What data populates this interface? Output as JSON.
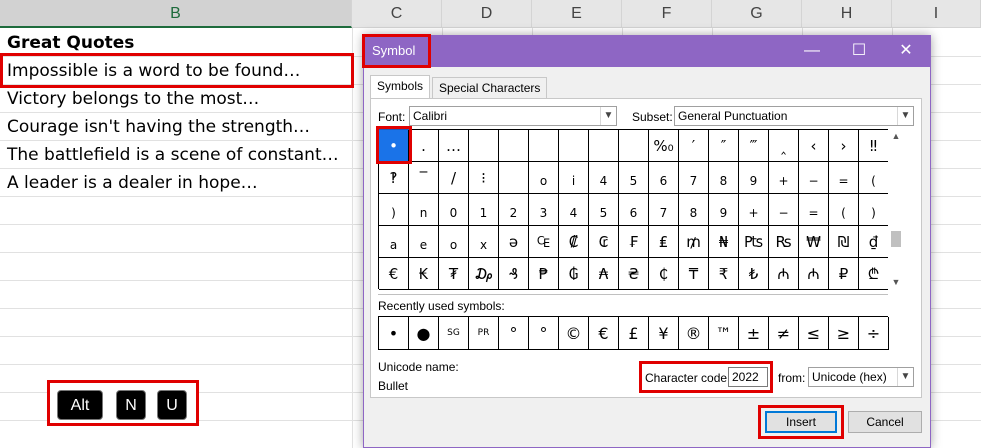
{
  "sheet": {
    "columns": [
      "B",
      "C",
      "D",
      "E",
      "F",
      "G",
      "H",
      "I"
    ],
    "cells": [
      "Great Quotes",
      "Impossible is a word to be found…",
      "Victory belongs to the most…",
      "Courage isn't having the strength…",
      "The battlefield is a scene of constant…",
      "A leader is a dealer in hope…"
    ]
  },
  "keys": [
    "Alt",
    "N",
    "U"
  ],
  "dialog": {
    "title": "Symbol",
    "controls": {
      "minimize": "—",
      "maximize": "☐",
      "close": "✕"
    },
    "tabs": [
      "Symbols",
      "Special Characters"
    ],
    "font_label": "Font:",
    "font_value": "Calibri",
    "subset_label": "Subset:",
    "subset_value": "General Punctuation",
    "symbols": [
      "•",
      ".",
      "…",
      "",
      "",
      "",
      "",
      "",
      "",
      "%₀",
      "′",
      "″",
      "‴",
      "‸",
      "‹",
      "›",
      "‼",
      "‽",
      "‾",
      "/",
      "⁝",
      "",
      "o",
      "i",
      "4",
      "5",
      "6",
      "7",
      "8",
      "9",
      "+",
      "−",
      "=",
      "(",
      ")",
      "n",
      "0",
      "1",
      "2",
      "3",
      "4",
      "5",
      "6",
      "7",
      "8",
      "9",
      "+",
      "−",
      "=",
      "(",
      ")",
      "a",
      "e",
      "o",
      "x",
      "ə",
      "₠",
      "₡",
      "₢",
      "₣",
      "₤",
      "₥",
      "₦",
      "₧",
      "₨",
      "₩",
      "₪",
      "₫",
      "€",
      "₭",
      "₮",
      "₯",
      "₰",
      "₱",
      "₲",
      "₳",
      "₴",
      "₵",
      "₸",
      "₹",
      "₺",
      "₼",
      "₼",
      "₽",
      "₾"
    ],
    "recent_label": "Recently used symbols:",
    "recent": [
      "•",
      "●",
      "SG",
      "PR",
      "°",
      "°",
      "©",
      "€",
      "£",
      "¥",
      "®",
      "™",
      "±",
      "≠",
      "≤",
      "≥",
      "÷"
    ],
    "unicode_name_label": "Unicode name:",
    "unicode_name": "Bullet",
    "char_code_label": "Character code:",
    "char_code": "2022",
    "from_label": "from:",
    "from_value": "Unicode (hex)",
    "insert_label": "Insert",
    "cancel_label": "Cancel"
  },
  "colors": {
    "title_bar": "#8e66c4",
    "highlight": "#e00000",
    "selected": "#1a73e8"
  }
}
